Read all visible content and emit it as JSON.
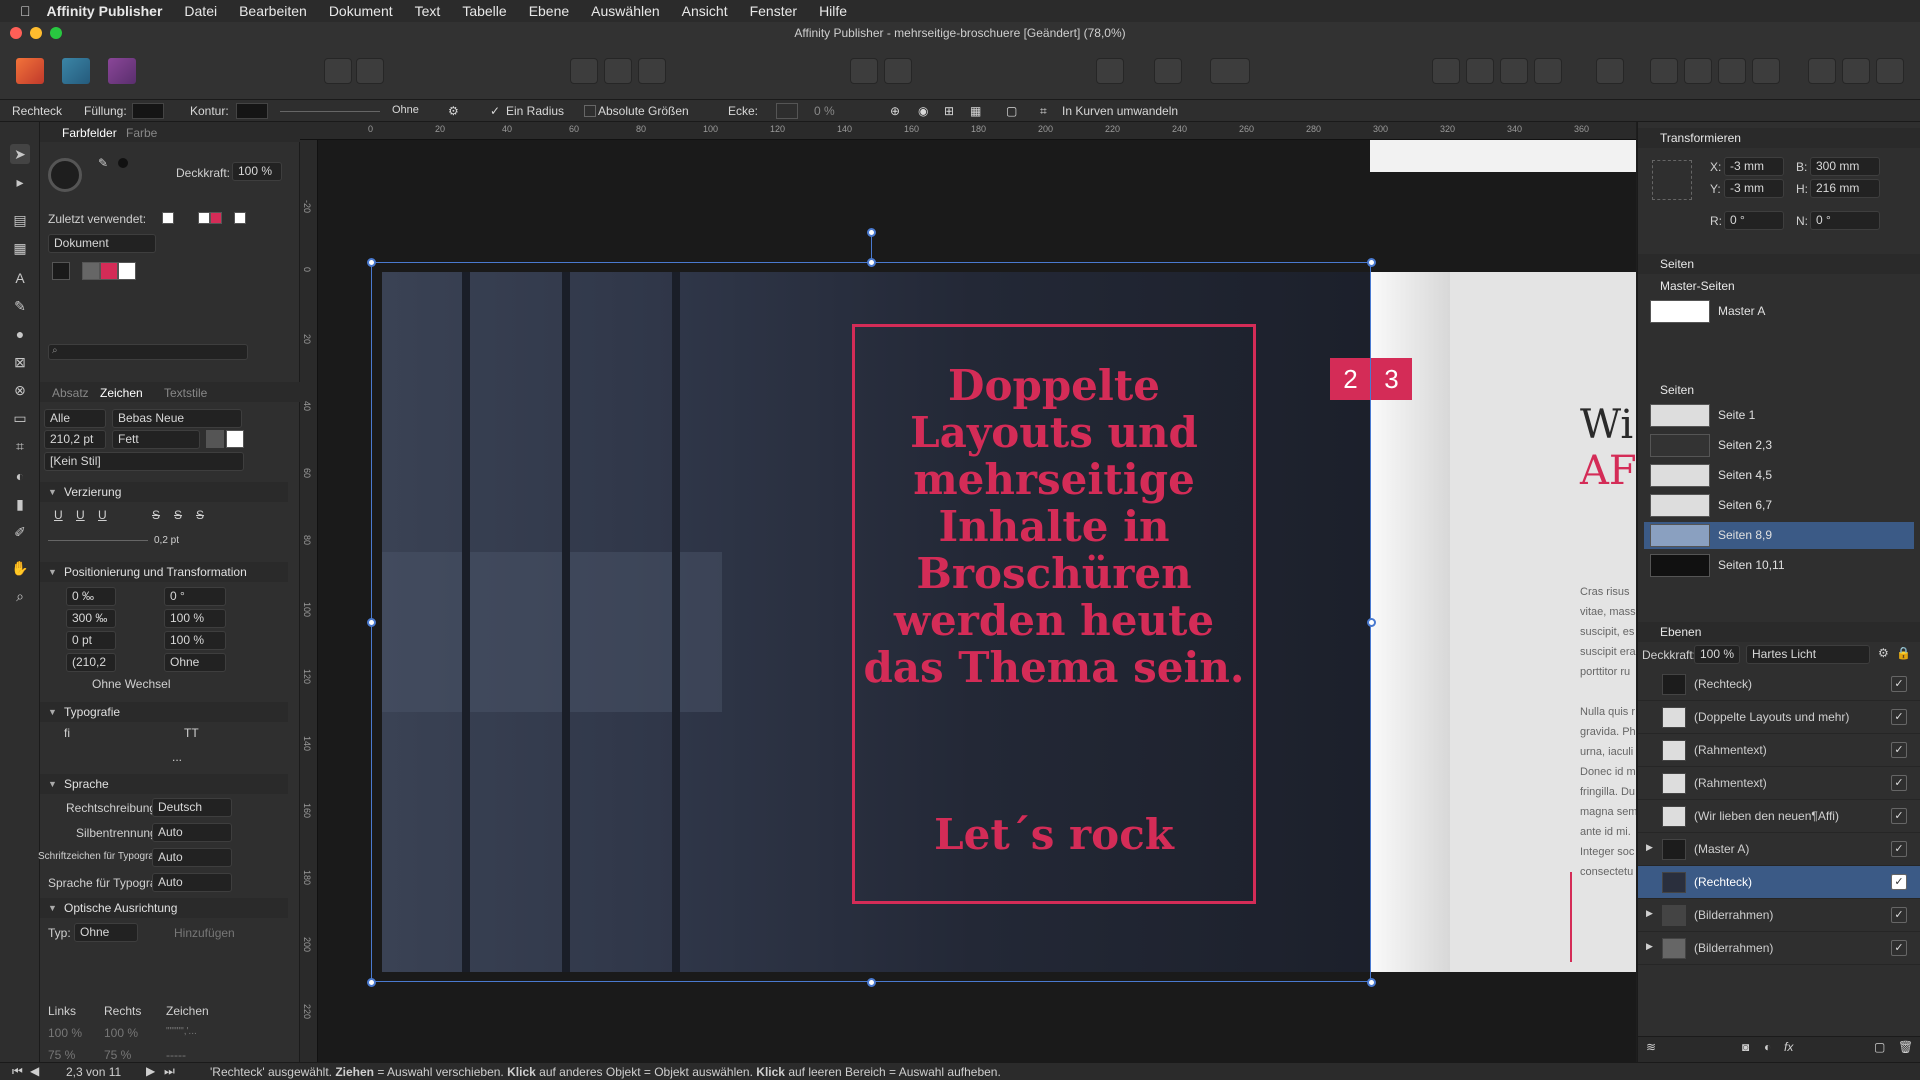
{
  "menubar": {
    "apple": "",
    "app": "Affinity Publisher",
    "items": [
      "Datei",
      "Bearbeiten",
      "Dokument",
      "Text",
      "Tabelle",
      "Ebene",
      "Auswählen",
      "Ansicht",
      "Fenster",
      "Hilfe"
    ]
  },
  "window": {
    "title": "Affinity Publisher - mehrseitige-broschuere [Geändert] (78,0%)"
  },
  "context": {
    "tool": "Rechteck",
    "fill_label": "Füllung:",
    "stroke_label": "Kontur:",
    "stroke_value": "Ohne",
    "one_radius": "Ein Radius",
    "absolute_sizes": "Absolute Größen",
    "corner_label": "Ecke:",
    "corner_value": "0 %",
    "convert": "In Kurven umwandeln"
  },
  "ruler": {
    "top": [
      "0",
      "20",
      "40",
      "60",
      "80",
      "100",
      "120",
      "140",
      "160",
      "180",
      "200",
      "220",
      "240",
      "260",
      "280",
      "300",
      "320",
      "340",
      "360"
    ],
    "left": [
      "-20",
      "0",
      "20",
      "40",
      "60",
      "80",
      "100",
      "120",
      "140",
      "160",
      "180",
      "200",
      "220"
    ]
  },
  "swatches": {
    "tab_active": "Farbfelder",
    "tab_other": "Farbe",
    "opacity_label": "Deckkraft:",
    "opacity_value": "100 %",
    "recent_label": "Zuletzt verwendet:",
    "palette": "Dokument"
  },
  "character": {
    "tabs": [
      "Absatz",
      "Zeichen",
      "Textstile"
    ],
    "font_collection": "Alle Schr...",
    "font": "Bebas Neue",
    "size": "210,2 pt",
    "weight": "Fett",
    "style": "[Kein Stil]"
  },
  "decoration": {
    "title": "Verzierung",
    "underline_weight": "0,2 pt"
  },
  "positioning": {
    "title": "Positionierung und Transformation",
    "tracking": "0 ‰",
    "shear": "0 °",
    "kerning": "300 ‰",
    "vscale": "100 %",
    "baseline": "0 pt",
    "hscale": "100 %",
    "leading": "(210,2",
    "leading_mode": "Ohne",
    "no_break": "Ohne Wechsel"
  },
  "typography": {
    "title": "Typografie",
    "more": "..."
  },
  "language": {
    "title": "Sprache",
    "spell_label": "Rechtschreibung:",
    "spell_value": "Deutsch",
    "hyph_label": "Silbentrennung:",
    "hyph_value": "Auto",
    "script_label": "Schriftzeichen für Typografie:",
    "script_value": "Auto",
    "lang_label": "Sprache für Typografie:",
    "lang_value": "Auto"
  },
  "optical": {
    "title": "Optische Ausrichtung",
    "type_label": "Typ:",
    "type_value": "Ohne",
    "add": "Hinzufügen",
    "cols": [
      "Links",
      "Rechts",
      "Zeichen"
    ],
    "row1": [
      "100 %",
      "100 %",
      "\"\"\"\"\",'..."
    ],
    "row2": [
      "75 %",
      "75 %",
      "-----"
    ]
  },
  "document": {
    "headline": "Doppelte Layouts und mehrseitige Inhalte in Broschüren werden heute das Thema sein.",
    "tagline": "Let´s rock",
    "page_left": "2",
    "page_right": "3",
    "right_heading_1": "Wi",
    "right_heading_2": "AF",
    "right_body": [
      "Cras risus",
      "vitae, mass",
      "suscipit, es",
      "suscipit era",
      "porttitor ru",
      "",
      "Nulla quis r",
      "gravida. Ph",
      "urna, iaculi",
      "Donec id m",
      "fringilla. Du",
      "magna sem",
      "ante id mi.",
      "Integer soc",
      "consectetu"
    ]
  },
  "transform": {
    "title": "Transformieren",
    "x_label": "X:",
    "x": "-3 mm",
    "y_label": "Y:",
    "y": "-3 mm",
    "b_label": "B:",
    "b": "300 mm",
    "h_label": "H:",
    "h": "216 mm",
    "r_label": "R:",
    "r": "0 °",
    "n_label": "N:",
    "n": "0 °"
  },
  "pages": {
    "title": "Seiten",
    "master_title": "Master-Seiten",
    "master": "Master A",
    "pages_title": "Seiten",
    "items": [
      "Seite 1",
      "Seiten 2,3",
      "Seiten 4,5",
      "Seiten 6,7",
      "Seiten 8,9",
      "Seiten 10,11"
    ],
    "selected_index": 4
  },
  "layers": {
    "title": "Ebenen",
    "opacity_label": "Deckkraft:",
    "opacity": "100 %",
    "blend": "Hartes Licht",
    "items": [
      "(Rechteck)",
      "(Doppelte Layouts und mehr)",
      "(Rahmentext)",
      "(Rahmentext)",
      "(Wir lieben den neuen¶Affi)",
      "(Master A)",
      "(Rechteck)",
      "(Bilderrahmen)",
      "(Bilderrahmen)"
    ],
    "selected_index": 6
  },
  "status": {
    "page": "2,3 von 11",
    "sel": "'Rechteck' ausgewählt.",
    "k1": "Ziehen",
    "t1": "= Auswahl verschieben.",
    "k2": "Klick",
    "t2": "auf anderes Objekt = Objekt auswählen.",
    "k3": "Klick",
    "t3": "auf leeren Bereich = Auswahl aufheben."
  },
  "colors": {
    "accent": "#d42c57",
    "selection": "#4a7ad0"
  }
}
